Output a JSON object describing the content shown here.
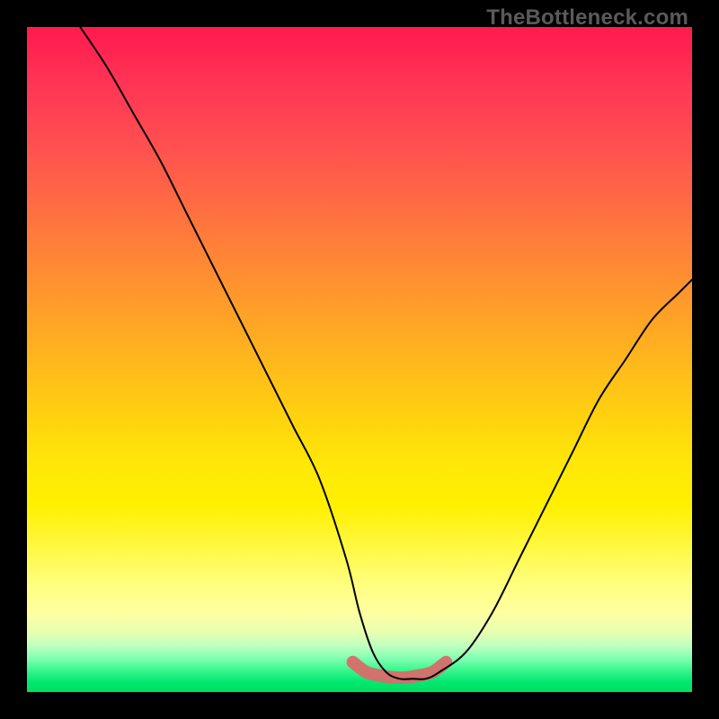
{
  "watermark": "TheBottleneck.com",
  "chart_data": {
    "type": "line",
    "title": "",
    "xlabel": "",
    "ylabel": "",
    "xlim": [
      0,
      100
    ],
    "ylim": [
      0,
      100
    ],
    "grid": false,
    "legend": false,
    "annotations": [],
    "background_gradient": {
      "type": "vertical",
      "stops": [
        {
          "pos": 0,
          "color": "#ff1a4d"
        },
        {
          "pos": 50,
          "color": "#ffd010"
        },
        {
          "pos": 90,
          "color": "#ffffa0"
        },
        {
          "pos": 100,
          "color": "#00e060"
        }
      ]
    },
    "series": [
      {
        "name": "bottleneck-curve",
        "color": "#000000",
        "x": [
          8,
          12,
          16,
          20,
          24,
          28,
          32,
          36,
          40,
          44,
          48,
          50,
          52,
          54,
          56,
          58,
          60,
          62,
          66,
          70,
          74,
          78,
          82,
          86,
          90,
          94,
          98,
          100
        ],
        "y": [
          100,
          94,
          87,
          80,
          72,
          64,
          56,
          48,
          40,
          32,
          20,
          12,
          6,
          3,
          2,
          2,
          2,
          3,
          6,
          12,
          20,
          28,
          36,
          44,
          50,
          56,
          60,
          62
        ]
      },
      {
        "name": "optimal-range-marker",
        "color": "#d96b6b",
        "x": [
          49,
          51,
          53,
          55,
          57,
          59,
          61,
          63
        ],
        "y": [
          4.5,
          3,
          2.5,
          2.2,
          2.2,
          2.5,
          3,
          4.5
        ]
      }
    ]
  }
}
